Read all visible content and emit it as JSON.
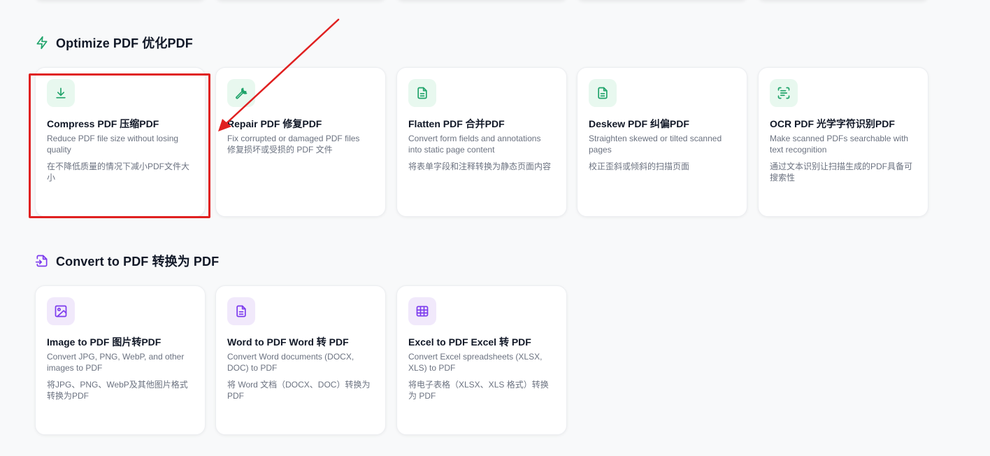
{
  "colors": {
    "optimize_accent": "#1fa36a",
    "convert_accent": "#7c3aed",
    "annotation_red": "#e02020"
  },
  "optimize_section": {
    "title": "Optimize PDF  优化PDF",
    "icon": "lightning-icon",
    "cards": [
      {
        "title": "Compress PDF 压缩PDF",
        "desc": "Reduce PDF file size without losing quality",
        "desc_zh": "在不降低质量的情况下减小PDF文件大小",
        "icon": "download-icon"
      },
      {
        "title": "Repair PDF 修复PDF",
        "desc": "Fix corrupted or damaged PDF files",
        "desc_zh": "修复损坏或受损的 PDF 文件",
        "icon": "wrench-icon"
      },
      {
        "title": "Flatten PDF 合并PDF",
        "desc": "Convert form fields and annotations into static page content",
        "desc_zh": "将表单字段和注释转换为静态页面内容",
        "icon": "document-icon"
      },
      {
        "title": "Deskew PDF 纠偏PDF",
        "desc": "Straighten skewed or tilted scanned pages",
        "desc_zh": "校正歪斜或倾斜的扫描页面",
        "icon": "document-icon"
      },
      {
        "title": "OCR PDF 光学字符识别PDF",
        "desc": "Make scanned PDFs searchable with text recognition",
        "desc_zh": "通过文本识别让扫描生成的PDF具备可搜索性",
        "icon": "scan-text-icon"
      }
    ]
  },
  "convert_section": {
    "title": "Convert to PDF  转换为 PDF",
    "icon": "file-import-icon",
    "cards": [
      {
        "title": "Image to PDF 图片转PDF",
        "desc": "Convert JPG, PNG, WebP, and other images to PDF",
        "desc_zh": "将JPG、PNG、WebP及其他图片格式转换为PDF",
        "icon": "image-icon"
      },
      {
        "title": "Word to PDF Word 转 PDF",
        "desc": "Convert Word documents (DOCX, DOC) to PDF",
        "desc_zh": "将 Word 文档（DOCX、DOC）转换为 PDF",
        "icon": "document-icon"
      },
      {
        "title": "Excel to PDF Excel 转 PDF",
        "desc": "Convert Excel spreadsheets (XLSX, XLS) to PDF",
        "desc_zh": "将电子表格（XLSX、XLS 格式）转换为 PDF",
        "icon": "table-icon"
      }
    ]
  }
}
